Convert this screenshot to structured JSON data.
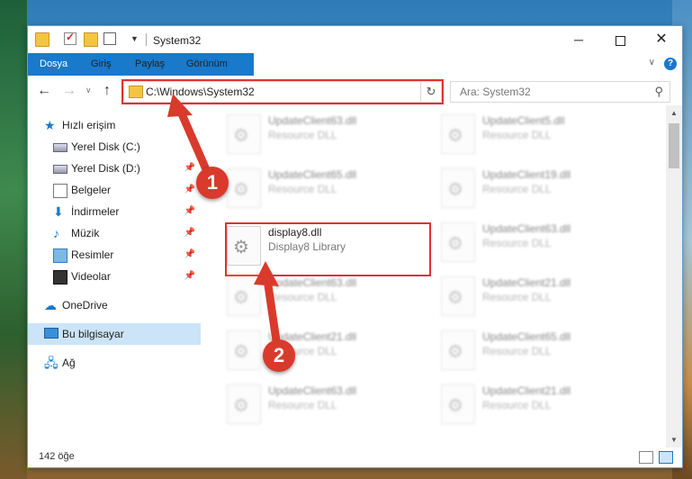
{
  "window": {
    "title": "System32",
    "controls": {
      "minimize": "─",
      "close": "✕"
    }
  },
  "ribbon": {
    "tabs": [
      "Dosya",
      "Giriş",
      "Paylaş",
      "Görünüm"
    ],
    "help": "?"
  },
  "address": {
    "path": "C:\\Windows\\System32",
    "search_placeholder": "Ara: System32"
  },
  "sidebar": {
    "items": [
      {
        "label": "Hızlı erişim",
        "icon": "star-icon"
      },
      {
        "label": "Yerel Disk (C:)",
        "icon": "drive-icon"
      },
      {
        "label": "Yerel Disk (D:)",
        "icon": "drive-icon"
      },
      {
        "label": "Belgeler",
        "icon": "document-icon"
      },
      {
        "label": "İndirmeler",
        "icon": "download-icon"
      },
      {
        "label": "Müzik",
        "icon": "music-icon"
      },
      {
        "label": "Resimler",
        "icon": "pictures-icon"
      },
      {
        "label": "Videolar",
        "icon": "video-icon"
      },
      {
        "label": "OneDrive",
        "icon": "cloud-icon"
      },
      {
        "label": "Bu bilgisayar",
        "icon": "computer-icon"
      },
      {
        "label": "Ağ",
        "icon": "network-icon"
      }
    ]
  },
  "files": [
    {
      "name": "UpdateClient63.dll",
      "desc": "Resource DLL"
    },
    {
      "name": "UpdateClient5.dll",
      "desc": "Resource DLL"
    },
    {
      "name": "UpdateClient65.dll",
      "desc": "Resource DLL"
    },
    {
      "name": "UpdateClient19.dll",
      "desc": "Resource DLL"
    },
    {
      "name": "display8.dll",
      "desc": "Display8 Library"
    },
    {
      "name": "UpdateClient63.dll",
      "desc": "Resource DLL"
    },
    {
      "name": "UpdateClient63.dll",
      "desc": "Resource DLL"
    },
    {
      "name": "UpdateClient21.dll",
      "desc": "Resource DLL"
    },
    {
      "name": "UpdateClient21.dll",
      "desc": "Resource DLL"
    },
    {
      "name": "UpdateClient65.dll",
      "desc": "Resource DLL"
    },
    {
      "name": "UpdateClient63.dll",
      "desc": "Resource DLL"
    },
    {
      "name": "UpdateClient21.dll",
      "desc": "Resource DLL"
    }
  ],
  "status": {
    "count": "142 öğe"
  },
  "annotations": {
    "step1": "1",
    "step2": "2"
  },
  "colors": {
    "accent": "#1979ca",
    "highlight": "#e0312e",
    "badge": "#d93a2b"
  }
}
